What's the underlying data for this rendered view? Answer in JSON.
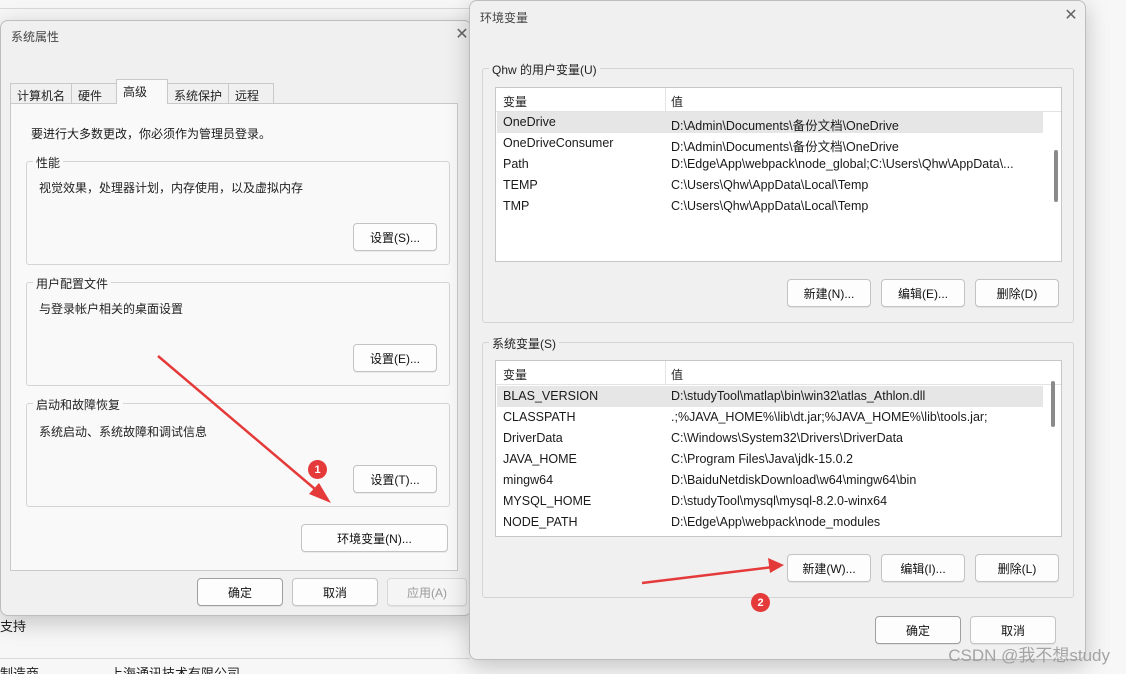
{
  "background": {
    "text_support": "支持",
    "text_bottom": "制造商",
    "text_bottom2": "上海通讯技术有限公司"
  },
  "sysprops": {
    "title": "系统属性",
    "close_glyph": "✕",
    "tabs": [
      "计算机名",
      "硬件",
      "高级",
      "系统保护",
      "远程"
    ],
    "admin_note": "要进行大多数更改，你必须作为管理员登录。",
    "performance": {
      "legend": "性能",
      "desc": "视觉效果，处理器计划，内存使用，以及虚拟内存",
      "button": "设置(S)..."
    },
    "profiles": {
      "legend": "用户配置文件",
      "desc": "与登录帐户相关的桌面设置",
      "button": "设置(E)..."
    },
    "startup": {
      "legend": "启动和故障恢复",
      "desc": "系统启动、系统故障和调试信息",
      "button": "设置(T)..."
    },
    "env_button": "环境变量(N)...",
    "ok": "确定",
    "cancel": "取消",
    "apply": "应用(A)"
  },
  "envvars": {
    "title": "环境变量",
    "close_glyph": "✕",
    "user_group": "Qhw 的用户变量(U)",
    "system_group": "系统变量(S)",
    "col_var": "变量",
    "col_val": "值",
    "user_vars": [
      {
        "name": "OneDrive",
        "value": "D:\\Admin\\Documents\\备份文档\\OneDrive"
      },
      {
        "name": "OneDriveConsumer",
        "value": "D:\\Admin\\Documents\\备份文档\\OneDrive"
      },
      {
        "name": "Path",
        "value": "D:\\Edge\\App\\webpack\\node_global;C:\\Users\\Qhw\\AppData\\..."
      },
      {
        "name": "TEMP",
        "value": "C:\\Users\\Qhw\\AppData\\Local\\Temp"
      },
      {
        "name": "TMP",
        "value": "C:\\Users\\Qhw\\AppData\\Local\\Temp"
      }
    ],
    "system_vars": [
      {
        "name": "BLAS_VERSION",
        "value": "D:\\studyTool\\matlap\\bin\\win32\\atlas_Athlon.dll"
      },
      {
        "name": "CLASSPATH",
        "value": ".;%JAVA_HOME%\\lib\\dt.jar;%JAVA_HOME%\\lib\\tools.jar;"
      },
      {
        "name": "DriverData",
        "value": "C:\\Windows\\System32\\Drivers\\DriverData"
      },
      {
        "name": "JAVA_HOME",
        "value": "C:\\Program Files\\Java\\jdk-15.0.2"
      },
      {
        "name": "mingw64",
        "value": "D:\\BaiduNetdiskDownload\\w64\\mingw64\\bin"
      },
      {
        "name": "MYSQL_HOME",
        "value": "D:\\studyTool\\mysql\\mysql-8.2.0-winx64"
      },
      {
        "name": "NODE_PATH",
        "value": "D:\\Edge\\App\\webpack\\node_modules"
      }
    ],
    "user_buttons": {
      "new": "新建(N)...",
      "edit": "编辑(E)...",
      "delete": "删除(D)"
    },
    "system_buttons": {
      "new": "新建(W)...",
      "edit": "编辑(I)...",
      "delete": "删除(L)"
    },
    "ok": "确定",
    "cancel": "取消"
  },
  "annotations": {
    "marker1": "1",
    "marker2": "2",
    "arrow_color": "#e53a3a"
  },
  "watermark": "CSDN @我不想study"
}
